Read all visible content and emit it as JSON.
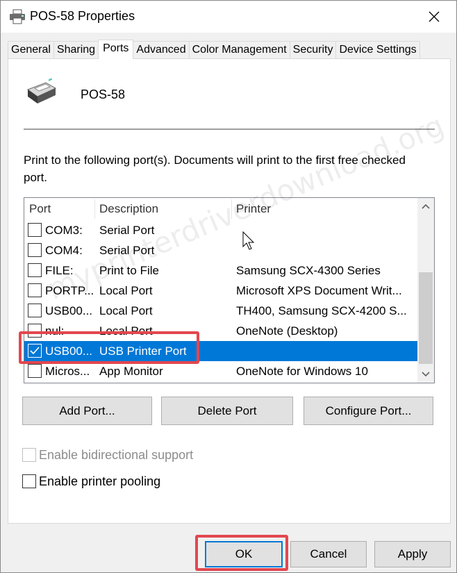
{
  "window": {
    "title": "POS-58 Properties"
  },
  "tabs": [
    {
      "label": "General"
    },
    {
      "label": "Sharing"
    },
    {
      "label": "Ports"
    },
    {
      "label": "Advanced"
    },
    {
      "label": "Color Management"
    },
    {
      "label": "Security"
    },
    {
      "label": "Device Settings"
    }
  ],
  "active_tab": "Ports",
  "printer": {
    "name": "POS-58"
  },
  "instructions": "Print to the following port(s). Documents will print to the first free checked port.",
  "port_list": {
    "headers": {
      "port": "Port",
      "description": "Description",
      "printer": "Printer"
    },
    "rows": [
      {
        "port": "COM3:",
        "description": "Serial Port",
        "printer": "",
        "checked": false,
        "selected": false
      },
      {
        "port": "COM4:",
        "description": "Serial Port",
        "printer": "",
        "checked": false,
        "selected": false
      },
      {
        "port": "FILE:",
        "description": "Print to File",
        "printer": "Samsung SCX-4300 Series",
        "checked": false,
        "selected": false
      },
      {
        "port": "PORTP...",
        "description": "Local Port",
        "printer": "Microsoft XPS Document Writ...",
        "checked": false,
        "selected": false
      },
      {
        "port": "USB00...",
        "description": "Local Port",
        "printer": "TH400, Samsung SCX-4200 S...",
        "checked": false,
        "selected": false
      },
      {
        "port": "nul:",
        "description": "Local Port",
        "printer": "OneNote (Desktop)",
        "checked": false,
        "selected": false
      },
      {
        "port": "USB00...",
        "description": "USB Printer Port",
        "printer": "",
        "checked": true,
        "selected": true
      },
      {
        "port": "Micros...",
        "description": "App Monitor",
        "printer": "OneNote for Windows 10",
        "checked": false,
        "selected": false
      }
    ]
  },
  "port_buttons": {
    "add": "Add Port...",
    "delete": "Delete Port",
    "configure": "Configure Port..."
  },
  "options": {
    "bidirectional": {
      "label": "Enable bidirectional support",
      "checked": false,
      "enabled": false
    },
    "pooling": {
      "label": "Enable printer pooling",
      "checked": false,
      "enabled": true
    }
  },
  "dialog_buttons": {
    "ok": "OK",
    "cancel": "Cancel",
    "apply": "Apply"
  },
  "watermark": "myprinterdriverdownload.org",
  "colors": {
    "selection": "#0078d7",
    "highlight": "#e2474f",
    "panel": "#ffffff",
    "window": "#f0f0f0"
  }
}
